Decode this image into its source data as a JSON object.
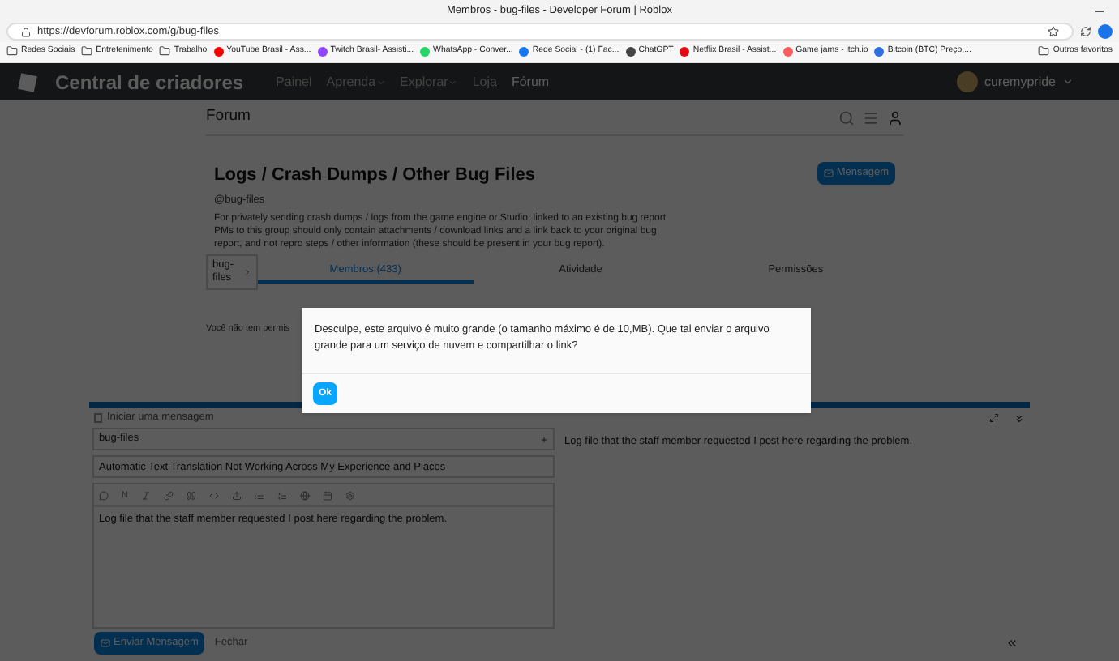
{
  "browser": {
    "title": "Membros - bug-files - Developer Forum | Roblox",
    "url": "https://devforum.roblox.com/g/bug-files",
    "bookmarks": [
      {
        "kind": "folder",
        "label": "Redes Sociais"
      },
      {
        "kind": "folder",
        "label": "Entretenimento"
      },
      {
        "kind": "folder",
        "label": "Trabalho"
      },
      {
        "kind": "site",
        "label": "YouTube Brasil - Ass...",
        "color": "#ff0000"
      },
      {
        "kind": "site",
        "label": "Twitch Brasil- Assisti...",
        "color": "#9146ff"
      },
      {
        "kind": "site",
        "label": "WhatsApp - Conver...",
        "color": "#25d366"
      },
      {
        "kind": "site",
        "label": "Rede Social - (1) Fac...",
        "color": "#1877f2"
      },
      {
        "kind": "site",
        "label": "ChatGPT",
        "color": "#444444"
      },
      {
        "kind": "site",
        "label": "Netflix Brasil - Assist...",
        "color": "#e50914"
      },
      {
        "kind": "site",
        "label": "Game jams - itch.io",
        "color": "#fa5c5c"
      },
      {
        "kind": "site",
        "label": "Bitcoin (BTC) Preço,...",
        "color": "#2f6fe4"
      }
    ],
    "other_bookmarks": "Outros favoritos"
  },
  "site_header": {
    "brand": "Central de criadores",
    "nav": [
      {
        "label": "Painel",
        "dropdown": false,
        "selected": false
      },
      {
        "label": "Aprenda",
        "dropdown": true,
        "selected": false
      },
      {
        "label": "Explorar",
        "dropdown": true,
        "selected": false
      },
      {
        "label": "Loja",
        "dropdown": false,
        "selected": false
      },
      {
        "label": "Fórum",
        "dropdown": false,
        "selected": true
      }
    ],
    "username": "curemypride"
  },
  "forum_bar": {
    "title": "Forum"
  },
  "group": {
    "title": "Logs / Crash Dumps / Other Bug Files",
    "handle": "@bug-files",
    "description": "For privately sending crash dumps / logs from the game engine or Studio, linked to an existing bug report. PMs to this group should only contain attachments / download links and a link back to your original bug report, and not repro steps / other information (these should be present in your bug report).",
    "message_button": "Mensagem",
    "nav_dropdown": "bug-files",
    "tabs": [
      {
        "label": "Membros (433)",
        "selected": true
      },
      {
        "label": "Atividade",
        "selected": false
      },
      {
        "label": "Permissões",
        "selected": false
      }
    ],
    "notice": "Você não tem permis"
  },
  "composer": {
    "title": "Iniciar uma mensagem",
    "recipient": "bug-files",
    "subject": "Automatic Text Translation Not Working Across My Experience and Places",
    "bold_button": "N",
    "body": "Log file that the staff member requested I post here regarding the problem.",
    "preview": "Log file that the staff member requested I post here regarding the problem.",
    "send_button": "Enviar Mensagem",
    "close_link": "Fechar"
  },
  "dialog": {
    "message": "Desculpe, este arquivo é muito grande (o tamanho máximo é de 10,MB). Que tal enviar o arquivo grande para um serviço de nuvem e compartilhar o link?",
    "ok_button": "Ok"
  }
}
